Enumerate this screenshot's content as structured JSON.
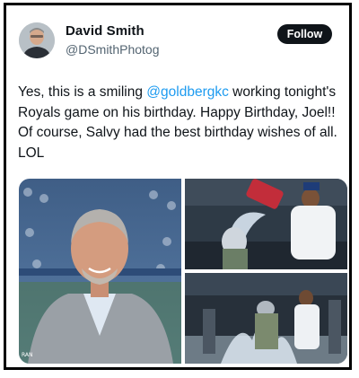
{
  "tweet": {
    "author": {
      "display_name": "David Smith",
      "handle": "@DSmithPhotog",
      "avatar_icon": "profile-photo"
    },
    "follow_label": "Follow",
    "text_parts": {
      "intro": "Yes, this is a smiling ",
      "mention": "@goldbergkc",
      "rest": "  working tonight's Royals game on his birthday. Happy Birthday, Joel!! Of course, Salvy had the best birthday wishes of all. LOL"
    },
    "media": {
      "photo_caption": "RAN"
    }
  },
  "colors": {
    "follow_bg": "#0f1419",
    "mention": "#1d9bf0",
    "handle": "#536471"
  }
}
